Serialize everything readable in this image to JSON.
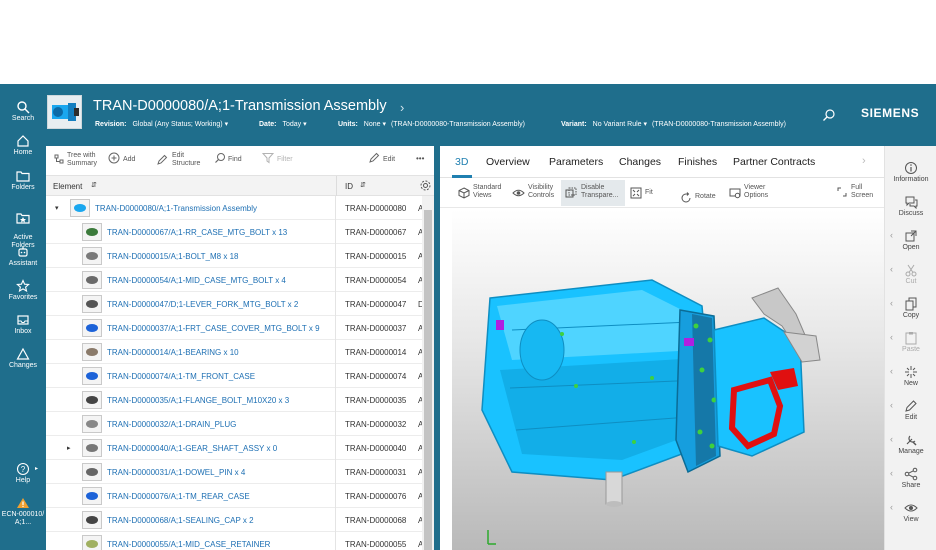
{
  "nav": {
    "items": [
      {
        "label": "Search",
        "icon": "search-icon"
      },
      {
        "label": "Home",
        "icon": "home-icon"
      },
      {
        "label": "Folders",
        "icon": "folder-icon"
      },
      {
        "label": "Active\nFolders",
        "icon": "active-folders-icon"
      },
      {
        "label": "Assistant",
        "icon": "assistant-icon"
      },
      {
        "label": "Favorites",
        "icon": "star-icon"
      },
      {
        "label": "Inbox",
        "icon": "inbox-icon"
      },
      {
        "label": "Changes",
        "icon": "changes-icon"
      }
    ],
    "help_label": "Help",
    "ecn_label": "ECN-000010/A;1..."
  },
  "header": {
    "title": "TRAN-D0000080/A;1-Transmission Assembly",
    "revision_label": "Revision:",
    "revision_value": "Global (Any Status; Working)",
    "date_label": "Date:",
    "date_value": "Today",
    "units_label": "Units:",
    "units_value": "None",
    "units_context": "(TRAN-D0000080-Transmission Assembly)",
    "variant_label": "Variant:",
    "variant_value": "No Variant Rule",
    "variant_context": "(TRAN-D0000080-Transmission Assembly)",
    "brand": "SIEMENS"
  },
  "toolbar": {
    "tree_summary": "Tree with\nSummary",
    "add": "Add",
    "edit_structure": "Edit\nStructure",
    "find": "Find",
    "filter": "Filter",
    "edit": "Edit",
    "more": "•••"
  },
  "table": {
    "col_element": "Element",
    "col_id": "ID",
    "rows": [
      {
        "name": "TRAN-D0000080/A;1-Transmission Assembly",
        "id": "TRAN-D0000080",
        "extra": "A",
        "level": 0,
        "expand": "▾"
      },
      {
        "name": "TRAN-D0000067/A;1-RR_CASE_MTG_BOLT x 13",
        "id": "TRAN-D0000067",
        "extra": "A",
        "level": 1,
        "expand": ""
      },
      {
        "name": "TRAN-D0000015/A;1-BOLT_M8 x 18",
        "id": "TRAN-D0000015",
        "extra": "A",
        "level": 1,
        "expand": ""
      },
      {
        "name": "TRAN-D0000054/A;1-MID_CASE_MTG_BOLT x 4",
        "id": "TRAN-D0000054",
        "extra": "A",
        "level": 1,
        "expand": ""
      },
      {
        "name": "TRAN-D0000047/D;1-LEVER_FORK_MTG_BOLT x 2",
        "id": "TRAN-D0000047",
        "extra": "D",
        "level": 1,
        "expand": ""
      },
      {
        "name": "TRAN-D0000037/A;1-FRT_CASE_COVER_MTG_BOLT x 9",
        "id": "TRAN-D0000037",
        "extra": "A",
        "level": 1,
        "expand": ""
      },
      {
        "name": "TRAN-D0000014/A;1-BEARING x 10",
        "id": "TRAN-D0000014",
        "extra": "A",
        "level": 1,
        "expand": ""
      },
      {
        "name": "TRAN-D0000074/A;1-TM_FRONT_CASE",
        "id": "TRAN-D0000074",
        "extra": "A",
        "level": 1,
        "expand": ""
      },
      {
        "name": "TRAN-D0000035/A;1-FLANGE_BOLT_M10X20 x 3",
        "id": "TRAN-D0000035",
        "extra": "A",
        "level": 1,
        "expand": ""
      },
      {
        "name": "TRAN-D0000032/A;1-DRAIN_PLUG",
        "id": "TRAN-D0000032",
        "extra": "A",
        "level": 1,
        "expand": ""
      },
      {
        "name": "TRAN-D0000040/A;1-GEAR_SHAFT_ASSY x 0",
        "id": "TRAN-D0000040",
        "extra": "A",
        "level": 1,
        "expand": "▸"
      },
      {
        "name": "TRAN-D0000031/A;1-DOWEL_PIN x 4",
        "id": "TRAN-D0000031",
        "extra": "A",
        "level": 1,
        "expand": ""
      },
      {
        "name": "TRAN-D0000076/A;1-TM_REAR_CASE",
        "id": "TRAN-D0000076",
        "extra": "A",
        "level": 1,
        "expand": ""
      },
      {
        "name": "TRAN-D0000068/A;1-SEALING_CAP x 2",
        "id": "TRAN-D0000068",
        "extra": "A",
        "level": 1,
        "expand": ""
      },
      {
        "name": "TRAN-D0000055/A;1-MID_CASE_RETAINER",
        "id": "TRAN-D0000055",
        "extra": "A",
        "level": 1,
        "expand": ""
      }
    ]
  },
  "viewer": {
    "tabs": [
      "3D",
      "Overview",
      "Parameters",
      "Changes",
      "Finishes",
      "Partner Contracts"
    ],
    "active_tab": "3D",
    "tools": {
      "standard_views": "Standard\nViews",
      "visibility_controls": "Visibility\nControls",
      "disable_transparency": "Disable\nTranspare...",
      "fit": "Fit",
      "rotate": "Rotate",
      "viewer_options": "Viewer\nOptions",
      "full_screen": "Full\nScreen"
    }
  },
  "rail": {
    "items": [
      {
        "label": "Information",
        "icon": "info-icon",
        "enabled": true
      },
      {
        "label": "Discuss",
        "icon": "discuss-icon",
        "enabled": true
      },
      {
        "label": "Open",
        "icon": "open-icon",
        "enabled": true
      },
      {
        "label": "Cut",
        "icon": "cut-icon",
        "enabled": false
      },
      {
        "label": "Copy",
        "icon": "copy-icon",
        "enabled": true
      },
      {
        "label": "Paste",
        "icon": "paste-icon",
        "enabled": false
      },
      {
        "label": "New",
        "icon": "new-icon",
        "enabled": true
      },
      {
        "label": "Edit",
        "icon": "edit-icon",
        "enabled": true
      },
      {
        "label": "Manage",
        "icon": "manage-icon",
        "enabled": true
      },
      {
        "label": "Share",
        "icon": "share-icon",
        "enabled": true
      },
      {
        "label": "View",
        "icon": "view-icon",
        "enabled": true
      }
    ]
  },
  "colors": {
    "header_bg": "#1f6e8c",
    "link": "#1d6fb3",
    "model_blue": "#1ec0ff",
    "accent": "#1f7fb0"
  }
}
